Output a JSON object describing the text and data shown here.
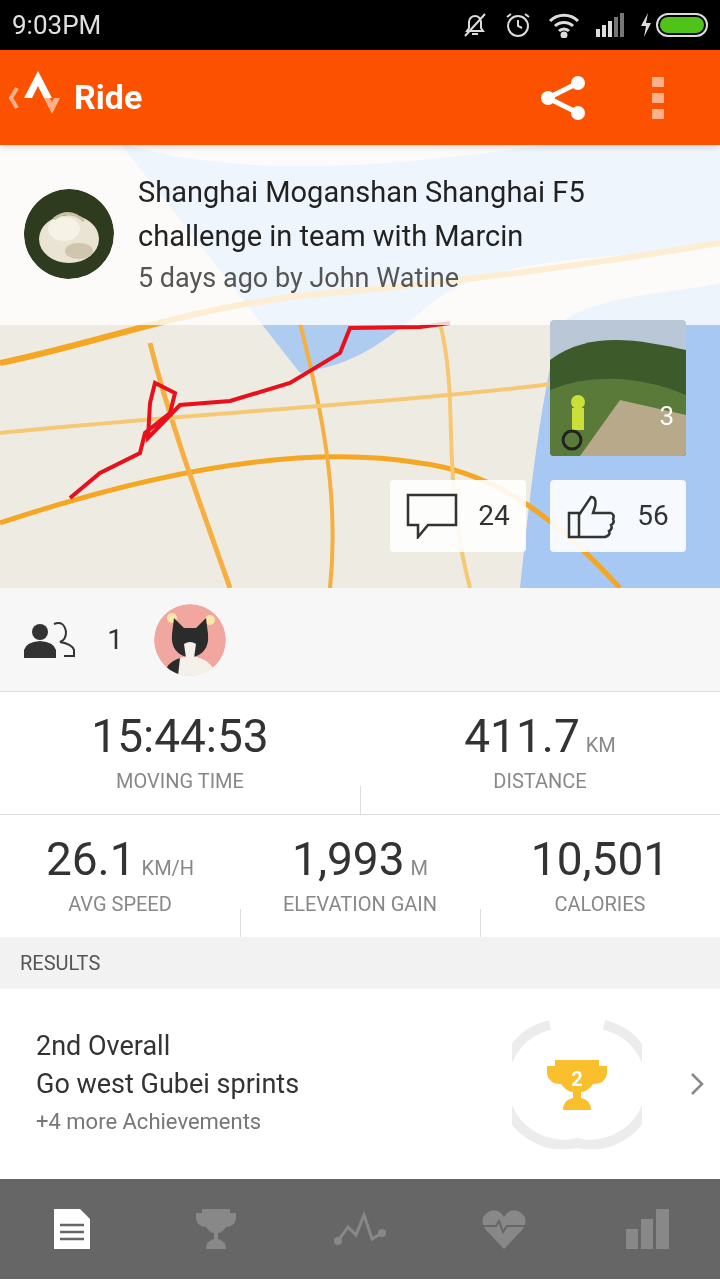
{
  "status_bar": {
    "time": "9:03PM"
  },
  "app_bar": {
    "title": "Ride"
  },
  "activity": {
    "title": "Shanghai Moganshan Shanghai F5 challenge in team with Marcin",
    "subtitle": "5 days ago by John Watine"
  },
  "photos": {
    "count": "3"
  },
  "comments": {
    "count": "24"
  },
  "kudos": {
    "count": "56"
  },
  "athletes": {
    "count": "1"
  },
  "stats": [
    [
      {
        "value": "15:44:53",
        "label": "MOVING TIME"
      },
      {
        "value": "411.7",
        "unit": "KM",
        "label": "DISTANCE"
      }
    ],
    [
      {
        "value": "26.1",
        "unit": "KM/H",
        "label": "AVG SPEED"
      },
      {
        "value": "1,993",
        "unit": "M",
        "label": "ELEVATION GAIN"
      },
      {
        "value": "10,501",
        "label": "CALORIES"
      }
    ]
  ],
  "results": {
    "header": "RESULTS",
    "rank": "2",
    "lines": [
      "2nd Overall",
      "Go west Gubei sprints",
      "+4 more Achievements"
    ]
  },
  "nav": [
    {
      "kind": "feed",
      "selected": true
    },
    {
      "kind": "trophy",
      "selected": false
    },
    {
      "kind": "analysis",
      "selected": false
    },
    {
      "kind": "heart",
      "selected": false
    },
    {
      "kind": "bars",
      "selected": false
    }
  ]
}
